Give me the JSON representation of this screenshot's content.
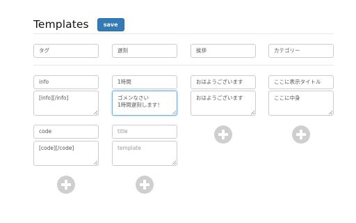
{
  "page": {
    "title": "Templates",
    "save_label": "save"
  },
  "columns": [
    {
      "name": "タグ",
      "items": [
        {
          "title": "info",
          "body": "[info][/info]"
        },
        {
          "title": "code",
          "body": "[code][/code]"
        }
      ]
    },
    {
      "name": "遅刻",
      "items": [
        {
          "title": "1時間",
          "body": "ゴメンなさい\n1時間遅刻します！"
        },
        {
          "title": "",
          "body": ""
        }
      ]
    },
    {
      "name": "挨拶",
      "items": [
        {
          "title": "おはようございます",
          "body": "おはようございます"
        }
      ]
    },
    {
      "name": "カテゴリー",
      "items": [
        {
          "title": "ここに表示タイトル",
          "body": "ここに中身"
        }
      ]
    }
  ],
  "placeholders": {
    "title": "title",
    "template": "template"
  },
  "icons": {
    "add": "plus-circle-icon",
    "resize": "resize-grip-icon"
  }
}
